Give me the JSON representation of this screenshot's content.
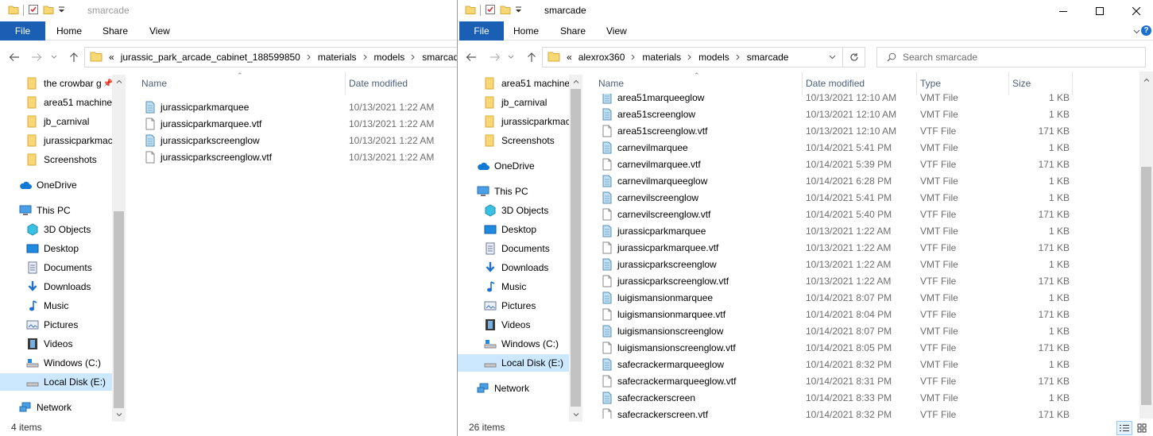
{
  "left": {
    "title": "smarcade",
    "tabs": {
      "file": "File",
      "home": "Home",
      "share": "Share",
      "view": "View"
    },
    "address": {
      "prefix": "«",
      "crumbs": [
        "jurassic_park_arcade_cabinet_188599850",
        "materials",
        "models",
        "smarcade"
      ]
    },
    "nav": {
      "quick_access": [
        "the crowbar g",
        "area51 machine",
        "jb_carnival",
        "jurassicparkmac",
        "Screenshots"
      ],
      "onedrive": "OneDrive",
      "this_pc": "This PC",
      "pc_items": [
        "3D Objects",
        "Desktop",
        "Documents",
        "Downloads",
        "Music",
        "Pictures",
        "Videos",
        "Windows (C:)",
        "Local Disk (E:)"
      ],
      "network": "Network"
    },
    "columns": {
      "name": "Name",
      "date": "Date modified"
    },
    "files": [
      {
        "name": "jurassicparkmarquee",
        "date": "10/13/2021 1:22 AM",
        "icon": "vmt"
      },
      {
        "name": "jurassicparkmarquee.vtf",
        "date": "10/13/2021 1:22 AM",
        "icon": "vtf"
      },
      {
        "name": "jurassicparkscreenglow",
        "date": "10/13/2021 1:22 AM",
        "icon": "vmt"
      },
      {
        "name": "jurassicparkscreenglow.vtf",
        "date": "10/13/2021 1:22 AM",
        "icon": "vtf"
      }
    ],
    "status": "4 items"
  },
  "right": {
    "title": "smarcade",
    "tabs": {
      "file": "File",
      "home": "Home",
      "share": "Share",
      "view": "View"
    },
    "address": {
      "prefix": "«",
      "crumbs": [
        "alexrox360",
        "materials",
        "models",
        "smarcade"
      ]
    },
    "search_placeholder": "Search smarcade",
    "nav": {
      "quick_access": [
        "area51 machine",
        "jb_carnival",
        "jurassicparkmac",
        "Screenshots"
      ],
      "onedrive": "OneDrive",
      "this_pc": "This PC",
      "pc_items": [
        "3D Objects",
        "Desktop",
        "Documents",
        "Downloads",
        "Music",
        "Pictures",
        "Videos",
        "Windows (C:)",
        "Local Disk (E:)"
      ],
      "network": "Network"
    },
    "columns": {
      "name": "Name",
      "date": "Date modified",
      "type": "Type",
      "size": "Size"
    },
    "files": [
      {
        "name": "area51marqueeglow",
        "date": "10/13/2021 12:10 AM",
        "type": "VMT File",
        "size": "1 KB",
        "icon": "vmt"
      },
      {
        "name": "area51screenglow",
        "date": "10/13/2021 12:10 AM",
        "type": "VMT File",
        "size": "1 KB",
        "icon": "vmt"
      },
      {
        "name": "area51screenglow.vtf",
        "date": "10/13/2021 12:10 AM",
        "type": "VTF File",
        "size": "171 KB",
        "icon": "vtf"
      },
      {
        "name": "carnevilmarquee",
        "date": "10/14/2021 5:41 PM",
        "type": "VMT File",
        "size": "1 KB",
        "icon": "vmt"
      },
      {
        "name": "carnevilmarquee.vtf",
        "date": "10/14/2021 5:39 PM",
        "type": "VTF File",
        "size": "171 KB",
        "icon": "vtf"
      },
      {
        "name": "carnevilmarqueeglow",
        "date": "10/14/2021 6:28 PM",
        "type": "VMT File",
        "size": "1 KB",
        "icon": "vmt"
      },
      {
        "name": "carnevilscreenglow",
        "date": "10/14/2021 5:41 PM",
        "type": "VMT File",
        "size": "1 KB",
        "icon": "vmt"
      },
      {
        "name": "carnevilscreenglow.vtf",
        "date": "10/14/2021 5:40 PM",
        "type": "VTF File",
        "size": "171 KB",
        "icon": "vtf"
      },
      {
        "name": "jurassicparkmarquee",
        "date": "10/13/2021 1:22 AM",
        "type": "VMT File",
        "size": "1 KB",
        "icon": "vmt"
      },
      {
        "name": "jurassicparkmarquee.vtf",
        "date": "10/13/2021 1:22 AM",
        "type": "VTF File",
        "size": "171 KB",
        "icon": "vtf"
      },
      {
        "name": "jurassicparkscreenglow",
        "date": "10/13/2021 1:22 AM",
        "type": "VMT File",
        "size": "1 KB",
        "icon": "vmt"
      },
      {
        "name": "jurassicparkscreenglow.vtf",
        "date": "10/13/2021 1:22 AM",
        "type": "VTF File",
        "size": "171 KB",
        "icon": "vtf"
      },
      {
        "name": "luigismansionmarquee",
        "date": "10/14/2021 8:07 PM",
        "type": "VMT File",
        "size": "1 KB",
        "icon": "vmt"
      },
      {
        "name": "luigismansionmarquee.vtf",
        "date": "10/14/2021 8:04 PM",
        "type": "VTF File",
        "size": "171 KB",
        "icon": "vtf"
      },
      {
        "name": "luigismansionscreenglow",
        "date": "10/14/2021 8:07 PM",
        "type": "VMT File",
        "size": "1 KB",
        "icon": "vmt"
      },
      {
        "name": "luigismansionscreenglow.vtf",
        "date": "10/14/2021 8:05 PM",
        "type": "VTF File",
        "size": "171 KB",
        "icon": "vtf"
      },
      {
        "name": "safecrackermarqueeglow",
        "date": "10/14/2021 8:32 PM",
        "type": "VMT File",
        "size": "1 KB",
        "icon": "vmt"
      },
      {
        "name": "safecrackermarqueeglow.vtf",
        "date": "10/14/2021 8:31 PM",
        "type": "VTF File",
        "size": "171 KB",
        "icon": "vtf"
      },
      {
        "name": "safecrackerscreen",
        "date": "10/14/2021 8:33 PM",
        "type": "VMT File",
        "size": "1 KB",
        "icon": "vmt"
      },
      {
        "name": "safecrackerscreen.vtf",
        "date": "10/14/2021 8:32 PM",
        "type": "VTF File",
        "size": "171 KB",
        "icon": "vtf"
      }
    ],
    "status": "26 items"
  },
  "colors": {
    "accent": "#1a5fb4",
    "selected": "#cce8ff",
    "header_text": "#4c607a",
    "folder": "#f8d775"
  }
}
